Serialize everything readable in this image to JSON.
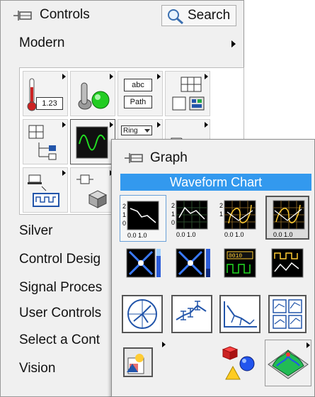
{
  "controls_palette": {
    "title": "Controls",
    "search_label": "Search",
    "modern_label": "Modern",
    "numeric_tile_value": "1.23",
    "string_tile_text": "abc",
    "path_tile_text": "Path",
    "ring_tile_text": "Ring",
    "categories": [
      {
        "label": "Silver"
      },
      {
        "label": "Control Desig"
      },
      {
        "label": "Signal Proces"
      },
      {
        "label": "User Controls"
      },
      {
        "label": "Select a Cont"
      },
      {
        "label": "Vision"
      }
    ]
  },
  "graph_palette": {
    "title": "Graph",
    "tooltip": "Waveform Chart"
  },
  "colors": {
    "accent_blue": "#3399ee",
    "palette_bg": "#f0f0f0",
    "led_green": "#22cc22",
    "thermometer_red": "#cc2222"
  },
  "icons": [
    "pin-icon",
    "search-icon",
    "graph-pin-icon"
  ]
}
